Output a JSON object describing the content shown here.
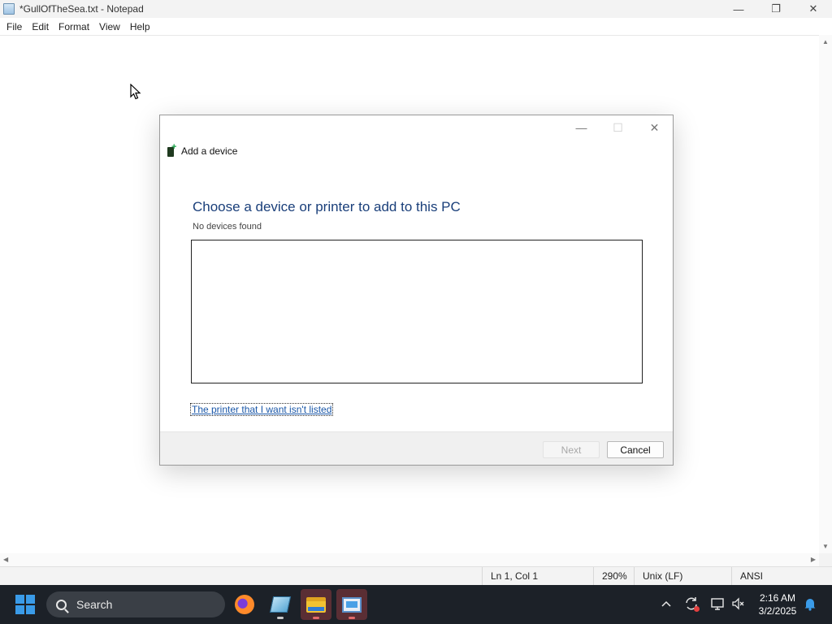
{
  "notepad": {
    "title": "*GullOfTheSea.txt - Notepad",
    "menu": [
      "File",
      "Edit",
      "Format",
      "View",
      "Help"
    ],
    "controls": {
      "minimize": "—",
      "restore": "❐",
      "close": "✕"
    },
    "status": {
      "position": "Ln 1, Col 1",
      "zoom": "290%",
      "line_ending": "Unix (LF)",
      "encoding": "ANSI"
    }
  },
  "dialog": {
    "header_title": "Add a device",
    "heading": "Choose a device or printer to add to this PC",
    "subheading": "No devices found",
    "link": "The printer that I want isn't listed",
    "next_label": "Next",
    "cancel_label": "Cancel",
    "controls": {
      "minimize": "—",
      "maximize": "☐",
      "close": "✕"
    }
  },
  "taskbar": {
    "search_placeholder": "Search",
    "apps": [
      "firefox-icon",
      "notepad-icon",
      "file-explorer-icon",
      "control-panel-icon"
    ],
    "tray": {
      "chevron": "^",
      "time": "2:16 AM",
      "date": "3/2/2025"
    }
  }
}
